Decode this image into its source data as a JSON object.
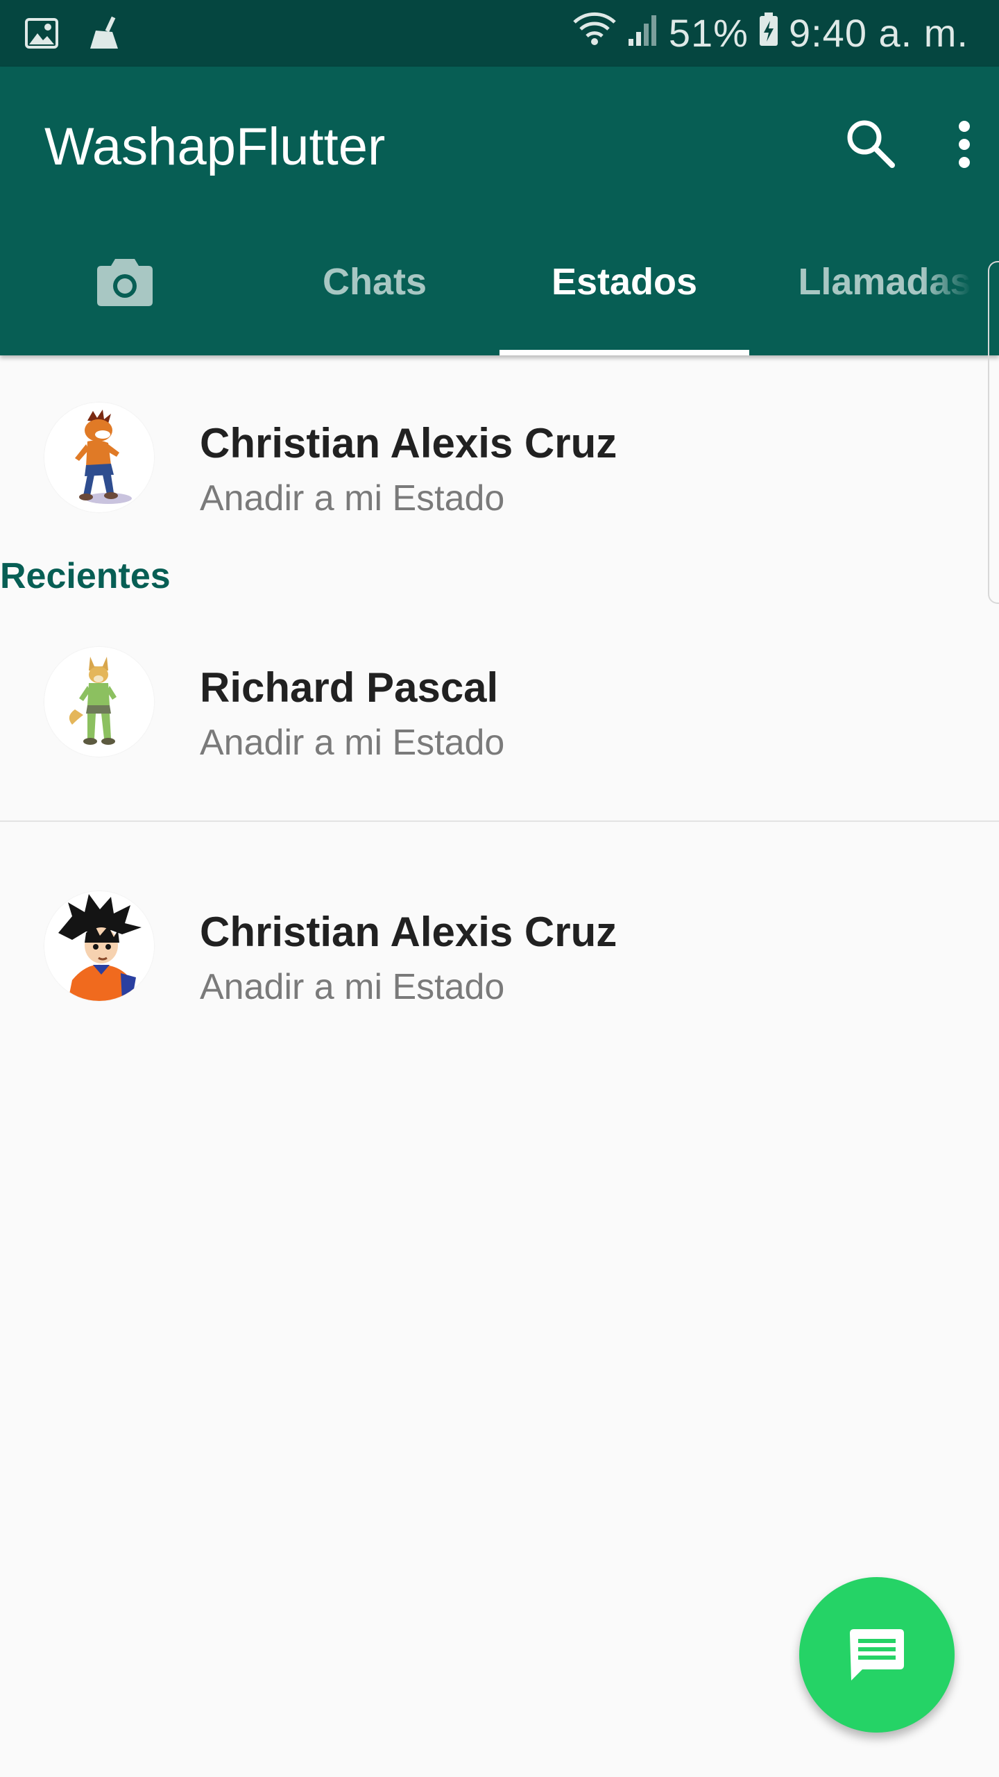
{
  "status_bar": {
    "battery_percent": "51%",
    "time": "9:40 a. m."
  },
  "app_bar": {
    "title": "WashapFlutter"
  },
  "tabs": [
    {
      "label": "",
      "icon": "camera-icon"
    },
    {
      "label": "Chats"
    },
    {
      "label": "Estados",
      "active": true
    },
    {
      "label": "Llamadas"
    }
  ],
  "my_status": {
    "name": "Christian Alexis Cruz",
    "subtitle": "Anadir a mi Estado",
    "avatar": "crash-bandicoot-avatar"
  },
  "recent_label": "Recientes",
  "recent": [
    {
      "name": "Richard Pascal",
      "subtitle": "Anadir a mi Estado",
      "avatar": "fox-avatar"
    },
    {
      "name": "Christian Alexis Cruz",
      "subtitle": "Anadir a mi Estado",
      "avatar": "goku-avatar"
    }
  ],
  "colors": {
    "status_bar": "#054640",
    "primary": "#075e54",
    "accent": "#25d366",
    "background": "#fafafa"
  }
}
